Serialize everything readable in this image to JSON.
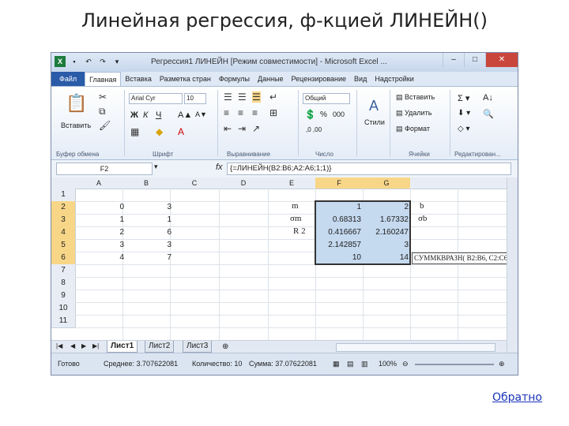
{
  "slide": {
    "title": "Линейная регрессия, ф-кцией ЛИНЕЙН()",
    "back_link": "Обратно"
  },
  "window": {
    "title": "Регрессия1 ЛИНЕЙН [Режим совместимости] - Microsoft Excel ...",
    "min": "–",
    "max": "□",
    "close": "✕"
  },
  "ribbon_tabs": [
    "Файл",
    "Главная",
    "Вставка",
    "Разметка стран",
    "Формулы",
    "Данные",
    "Рецензирование",
    "Вид",
    "Надстройки"
  ],
  "ribbon": {
    "paste_label": "Вставить",
    "clipboard_group": "Буфер обмена",
    "font_group": "Шрифт",
    "align_group": "Выравнивание",
    "number_group": "Число",
    "cells_group": "Ячейки",
    "editing_group": "Редактирован...",
    "font_name": "Arial Cyr",
    "font_size": "10",
    "number_format": "Общий",
    "insert_label": "Вставить",
    "delete_label": "Удалить",
    "format_label": "Формат",
    "styles_label": "Стили"
  },
  "formula_bar": {
    "name_box": "F2",
    "fx": "fx",
    "formula": "{=ЛИНЕЙН(B2:B6;A2:A6;1;1)}"
  },
  "columns": [
    "A",
    "B",
    "C",
    "D",
    "E",
    "F",
    "G"
  ],
  "rows": [
    "1",
    "2",
    "3",
    "4",
    "5",
    "6",
    "7",
    "8",
    "9",
    "10",
    "11"
  ],
  "cells": {
    "A2": "0",
    "B2": "3",
    "A3": "1",
    "B3": "1",
    "A4": "2",
    "B4": "6",
    "A5": "3",
    "B5": "3",
    "A6": "4",
    "B6": "7",
    "F2": "1",
    "G2": "2",
    "F3": "0.68313",
    "G3": "1.67332",
    "F4": "0.416667",
    "G4": "2.160247",
    "F5": "2.142857",
    "G5": "3",
    "F6": "10",
    "G6": "14"
  },
  "labels": {
    "m": "m",
    "sigma_m": "σm",
    "r2": "R 2",
    "b": "b",
    "sigma_b": "σb",
    "callout": "СУММКВРАЗН( B2:B6, C2:C6)"
  },
  "sheets": [
    "Лист1",
    "Лист2",
    "Лист3"
  ],
  "status": {
    "ready": "Готово",
    "average": "Среднее: 3.707622081",
    "count": "Количество: 10",
    "sum": "Сумма: 37.07622081",
    "zoom": "100%"
  }
}
